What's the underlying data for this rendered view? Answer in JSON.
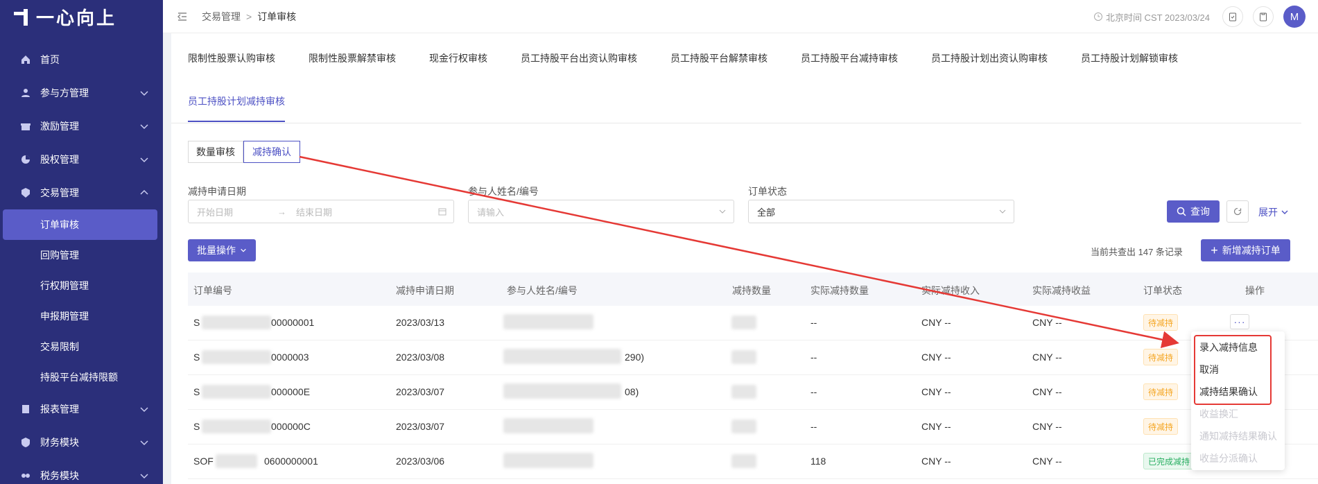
{
  "brand": {
    "name": "一心向上"
  },
  "sidebar": {
    "items": [
      {
        "label": "首页",
        "icon": "home-icon"
      },
      {
        "label": "参与方管理",
        "icon": "users-icon"
      },
      {
        "label": "激励管理",
        "icon": "gift-icon"
      },
      {
        "label": "股权管理",
        "icon": "pie-icon"
      },
      {
        "label": "交易管理",
        "icon": "trade-icon"
      }
    ],
    "sub_items": [
      {
        "label": "订单审核"
      },
      {
        "label": "回购管理"
      },
      {
        "label": "行权期管理"
      },
      {
        "label": "申报期管理"
      },
      {
        "label": "交易限制"
      },
      {
        "label": "持股平台减持限额"
      }
    ],
    "items_after": [
      {
        "label": "报表管理",
        "icon": "report-icon"
      },
      {
        "label": "财务模块",
        "icon": "finance-icon"
      },
      {
        "label": "税务模块",
        "icon": "tax-icon"
      }
    ]
  },
  "header": {
    "breadcrumb": [
      "交易管理",
      "订单审核"
    ],
    "time": "北京时间 CST 2023/03/24",
    "avatar": "M"
  },
  "tabs": [
    "限制性股票认购审核",
    "限制性股票解禁审核",
    "现金行权审核",
    "员工持股平台出资认购审核",
    "员工持股平台解禁审核",
    "员工持股平台减持审核",
    "员工持股计划出资认购审核",
    "员工持股计划解锁审核",
    "员工持股计划减持审核"
  ],
  "segments": [
    "数量审核",
    "减持确认"
  ],
  "filters": {
    "date_label": "减持申请日期",
    "start_placeholder": "开始日期",
    "end_placeholder": "结束日期",
    "participant_label": "参与人姓名/编号",
    "participant_placeholder": "请输入",
    "status_label": "订单状态",
    "status_value": "全部",
    "query_label": "查询",
    "expand_label": "展开"
  },
  "toolbar": {
    "batch_label": "批量操作",
    "count_text": "当前共查出 147 条记录",
    "add_label": "新增减持订单"
  },
  "table": {
    "headers": [
      "订单编号",
      "减持申请日期",
      "参与人姓名/编号",
      "减持数量",
      "实际减持数量",
      "实际减持收入",
      "实际减持收益",
      "订单状态",
      "操作"
    ],
    "rows": [
      {
        "id_prefix": "S",
        "id_suffix": "00000001",
        "date": "2023/03/13",
        "participant_suffix": "",
        "actual_qty": "--",
        "income": "CNY --",
        "profit": "CNY --",
        "status": "待减持",
        "status_type": "warn"
      },
      {
        "id_prefix": "S",
        "id_suffix": "0000003",
        "date": "2023/03/08",
        "participant_suffix": "290)",
        "actual_qty": "--",
        "income": "CNY --",
        "profit": "CNY --",
        "status": "待减持",
        "status_type": "warn"
      },
      {
        "id_prefix": "S",
        "id_suffix": "000000E",
        "date": "2023/03/07",
        "participant_suffix": "08)",
        "actual_qty": "--",
        "income": "CNY --",
        "profit": "CNY --",
        "status": "待减持",
        "status_type": "warn"
      },
      {
        "id_prefix": "S",
        "id_suffix": "000000C",
        "date": "2023/03/07",
        "participant_suffix": "",
        "actual_qty": "--",
        "income": "CNY --",
        "profit": "CNY --",
        "status": "待减持",
        "status_type": "warn"
      },
      {
        "id_prefix": "SOF",
        "id_suffix": "0600000001",
        "date": "2023/03/06",
        "participant_suffix": "",
        "actual_qty": "118",
        "income": "CNY --",
        "profit": "CNY --",
        "status": "已完成减持",
        "status_type": "done"
      }
    ]
  },
  "action_menu": {
    "more_label": "···",
    "items": [
      {
        "label": "录入减持信息",
        "enabled": true
      },
      {
        "label": "取消",
        "enabled": true
      },
      {
        "label": "减持结果确认",
        "enabled": true
      },
      {
        "label": "收益换汇",
        "enabled": false
      },
      {
        "label": "通知减持结果确认",
        "enabled": false
      },
      {
        "label": "收益分派确认",
        "enabled": false
      }
    ]
  },
  "colors": {
    "primary": "#5a5cc8",
    "sidebar": "#2b2f7a",
    "annotation": "#e53935",
    "warn": "#f5a623",
    "success": "#27ae60"
  }
}
